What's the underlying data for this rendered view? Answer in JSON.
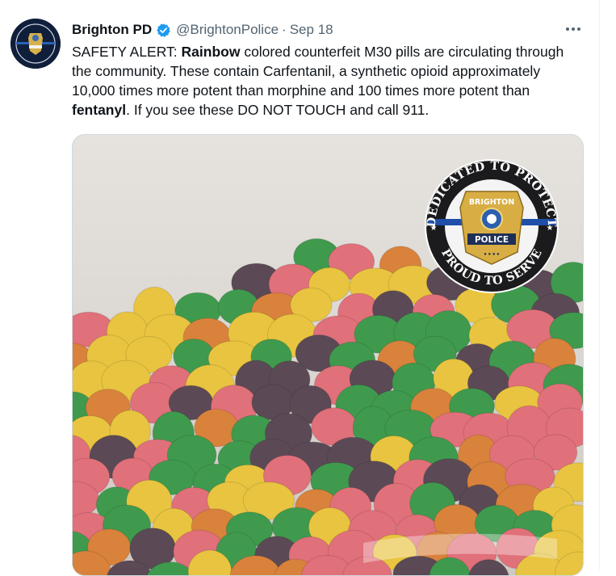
{
  "tweet": {
    "display_name": "Brighton PD",
    "handle": "@BrightonPolice",
    "separator": "·",
    "date": "Sep 18",
    "body_parts": [
      "SAFETY ALERT: ",
      "Rainbow",
      " colored counterfeit M30 pills are circulating through the community. These contain Carfentanil, a synthetic opioid approximately 10,000 times more potent than morphine and 100 times more potent than ",
      "fentanyl",
      ". If you see these DO NOT TOUCH and call 911."
    ]
  },
  "badge": {
    "top_arc": "DEDICATED TO PROTECT",
    "bottom_arc": "PROUD TO SERVE",
    "shield_top": "BRIGHTON",
    "shield_banner": "POLICE"
  },
  "colors": {
    "verified": "#1d9bf0",
    "pill_pink": "#e0707a",
    "pill_purple": "#5b4a55",
    "pill_yellow": "#e8c440",
    "pill_green": "#3f9a4e",
    "pill_orange": "#d8823c"
  },
  "icons": {
    "verified": "verified-badge-icon",
    "more": "more-horizontal-icon"
  }
}
